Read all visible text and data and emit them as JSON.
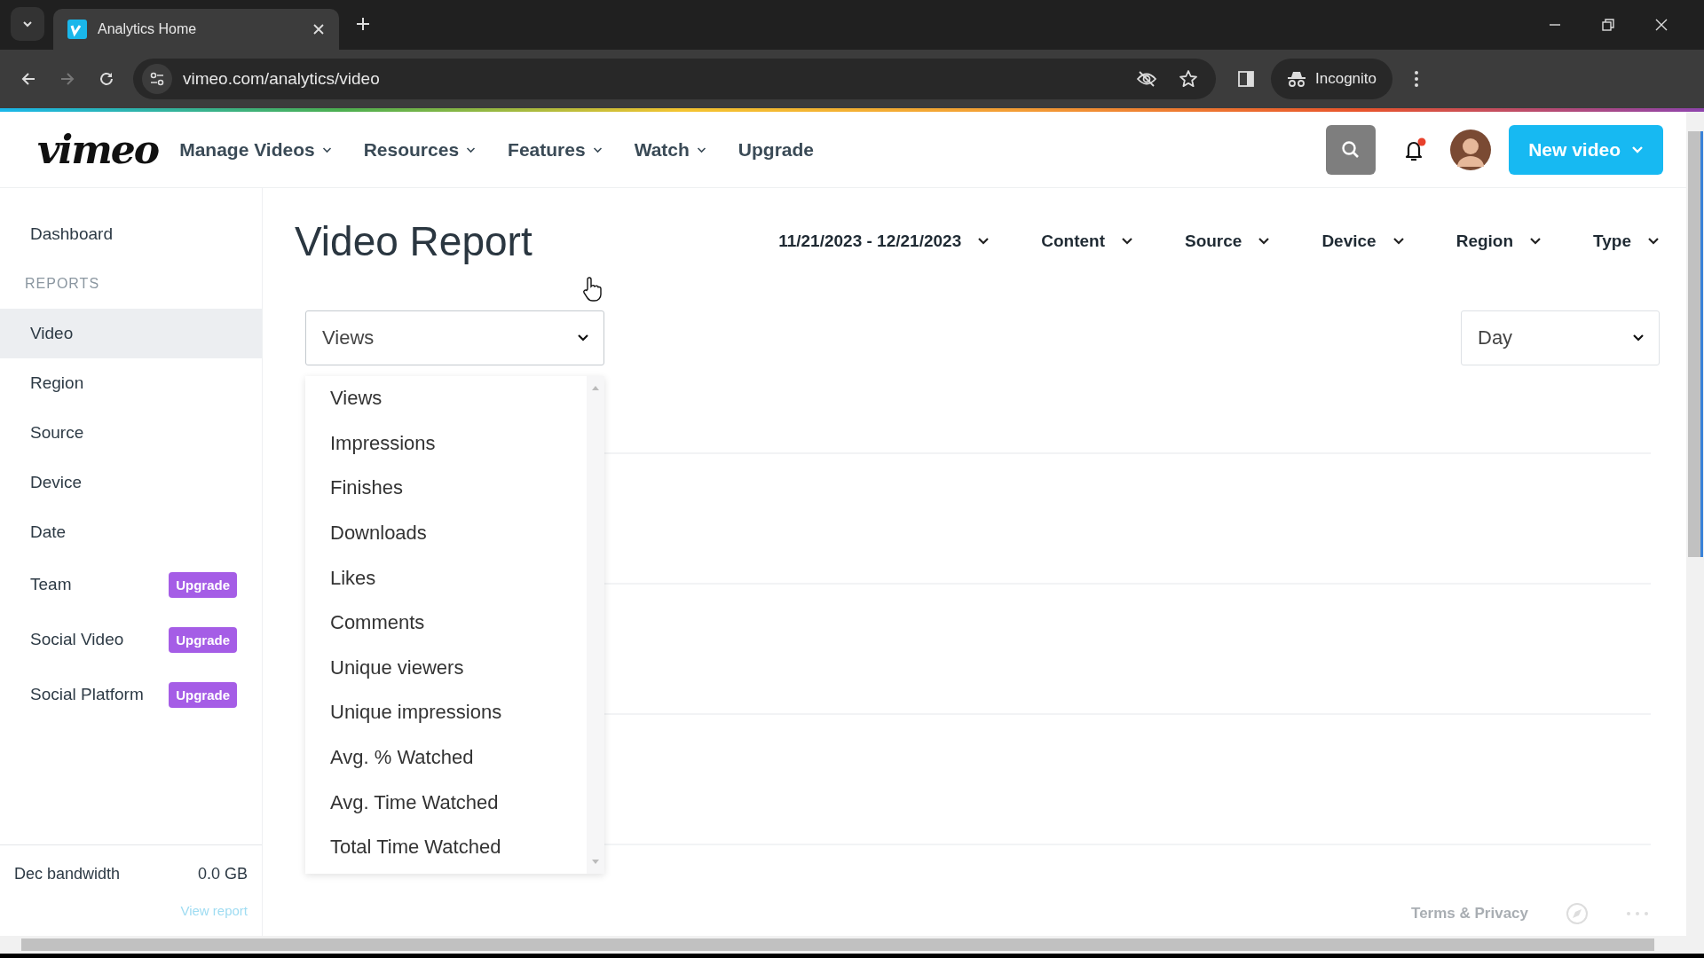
{
  "browser": {
    "tab_title": "Analytics Home",
    "url": "vimeo.com/analytics/video",
    "profile_label": "Incognito"
  },
  "header": {
    "logo": "vimeo",
    "nav": [
      {
        "label": "Manage Videos",
        "kind": "menu"
      },
      {
        "label": "Resources",
        "kind": "menu"
      },
      {
        "label": "Features",
        "kind": "menu"
      },
      {
        "label": "Watch",
        "kind": "menu"
      },
      {
        "label": "Upgrade",
        "kind": "link"
      }
    ],
    "notifications_unread": true,
    "new_video_label": "New video"
  },
  "sidebar": {
    "items": [
      {
        "label": "Dashboard",
        "kind": "link",
        "selected": false
      },
      {
        "label": "REPORTS",
        "kind": "heading"
      },
      {
        "label": "Video",
        "kind": "link",
        "selected": true
      },
      {
        "label": "Region",
        "kind": "link",
        "selected": false
      },
      {
        "label": "Source",
        "kind": "link",
        "selected": false
      },
      {
        "label": "Device",
        "kind": "link",
        "selected": false
      },
      {
        "label": "Date",
        "kind": "link",
        "selected": false
      },
      {
        "label": "Team",
        "kind": "link",
        "selected": false,
        "badge": "Upgrade"
      },
      {
        "label": "Social Video",
        "kind": "link",
        "selected": false,
        "badge": "Upgrade"
      },
      {
        "label": "Social Platform",
        "kind": "link",
        "selected": false,
        "badge": "Upgrade"
      }
    ],
    "bandwidth": {
      "label": "Dec bandwidth",
      "value": "0.0 GB",
      "link": "View report"
    }
  },
  "report": {
    "title": "Video Report",
    "filters": [
      "11/21/2023 - 12/21/2023",
      "Content",
      "Source",
      "Device",
      "Region",
      "Type"
    ],
    "metric": {
      "value": "Views",
      "expanded": true,
      "options": [
        "Views",
        "Impressions",
        "Finishes",
        "Downloads",
        "Likes",
        "Comments",
        "Unique viewers",
        "Unique impressions",
        "Avg. % Watched",
        "Avg. Time Watched",
        "Total Time Watched"
      ]
    },
    "interval": {
      "value": "Day"
    }
  },
  "footer": {
    "link": "Terms & Privacy"
  }
}
